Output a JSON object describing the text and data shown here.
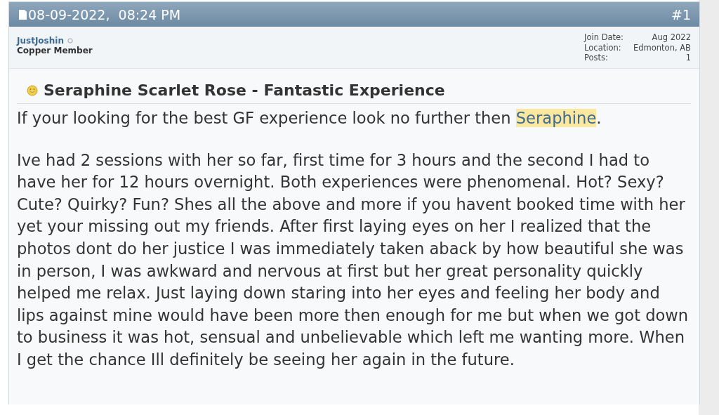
{
  "post": {
    "date": "08-09-2022,  08:24 PM",
    "number": "#1",
    "author": {
      "name": "JustJoshin",
      "online": false,
      "rank": "Copper Member"
    },
    "details": [
      {
        "label": "Join Date:",
        "value": "Aug 2022"
      },
      {
        "label": "Location:",
        "value": "Edmonton, AB"
      },
      {
        "label": "Posts:",
        "value": "1"
      }
    ],
    "title": "Seraphine Scarlet Rose - Fantastic Experience",
    "paragraphs": [
      [
        {
          "kind": "plain",
          "text": "If your looking for the best GF experience look no further then "
        },
        {
          "kind": "highlight",
          "text": "Seraphine"
        },
        {
          "kind": "plain",
          "text": "."
        }
      ],
      [
        {
          "kind": "plain",
          "text": "Ive had 2 sessions with her so far, first time for 3 hours and the second I had to have her for 12 hours overnight. Both experiences were phenomenal. Hot? Sexy? Cute? Quirky? Fun? Shes all the above and more if you havent booked time with her yet your missing out my friends. After first laying eyes on her I realized that the photos dont do her justice I was immediately taken aback by how beautiful she was in person, I was awkward and nervous at first but her great personality quickly helped me relax. Just laying down staring into her eyes and feeling her body and lips against mine would have been more then enough for me but when we got down to business it was hot, sensual and unbelievable which left me wanting more. When I get the chance Ill definitely be seeing her again in the future."
        }
      ]
    ]
  }
}
